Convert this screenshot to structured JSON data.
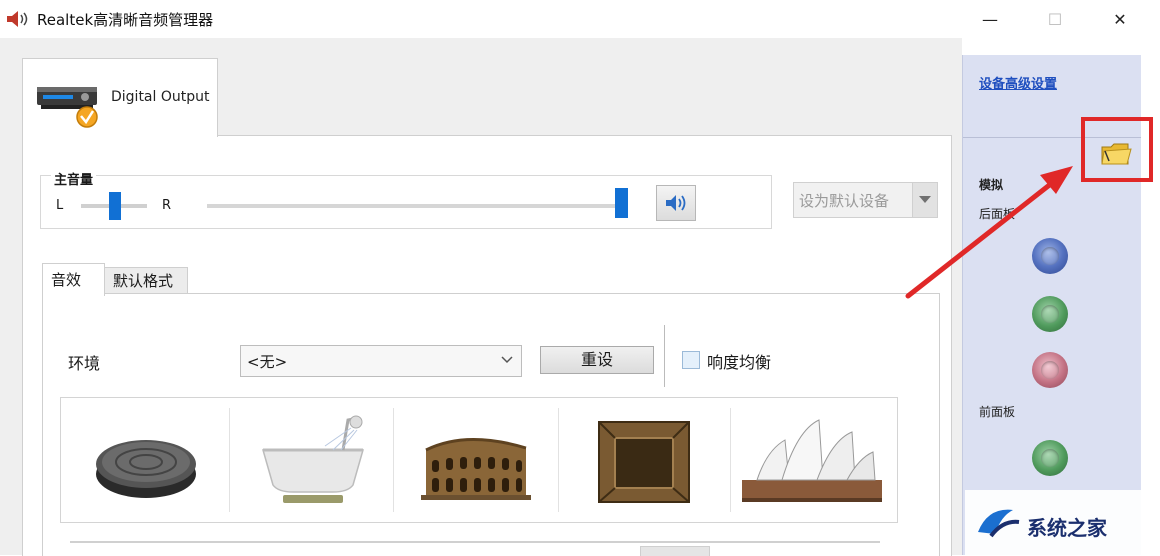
{
  "window": {
    "title": "Realtek高清晰音频管理器",
    "icons": {
      "app": "speaker-app-icon",
      "minimize": "minimize-icon",
      "maximize": "maximize-icon",
      "close": "close-icon"
    },
    "controls": {
      "minimize": "—",
      "maximize": "☐",
      "close": "✕"
    }
  },
  "device_tab": {
    "label": "Digital Output",
    "icon": "digital-output-device-icon"
  },
  "master_volume": {
    "legend": "主音量",
    "left_label": "L",
    "right_label": "R",
    "balance": 0.5,
    "volume": 1.0,
    "mute_icon": "speaker-volume-icon"
  },
  "default_device": {
    "label": "设为默认设备"
  },
  "tabs": [
    {
      "label": "音效",
      "active": true
    },
    {
      "label": "默认格式",
      "active": false
    }
  ],
  "effects": {
    "environment_label": "环境",
    "environment_value": "<无>",
    "reset_label": "重设",
    "loudness_label": "响度均衡",
    "loudness_checked": false,
    "presets": [
      {
        "icon": "sewer-pipe-icon"
      },
      {
        "icon": "bathroom-icon"
      },
      {
        "icon": "colosseum-icon"
      },
      {
        "icon": "stone-room-icon"
      },
      {
        "icon": "opera-house-icon"
      }
    ]
  },
  "side_panel": {
    "advanced_link": "设备高级设置",
    "analog_label": "模拟",
    "rear_panel_label": "后面板",
    "front_panel_label": "前面板",
    "folder_icon": "folder-icon",
    "jacks": [
      {
        "panel": "rear",
        "color": "#5572c0"
      },
      {
        "panel": "rear",
        "color": "#4f9a5c"
      },
      {
        "panel": "rear",
        "color": "#c27183"
      },
      {
        "panel": "front",
        "color": "#4f9a5c"
      }
    ]
  },
  "annotation": {
    "color": "#e02828"
  },
  "watermark": {
    "text": "系统之家"
  },
  "colors": {
    "slider_thumb": "#1170d4",
    "side_panel_bg": "#dbe0f2"
  }
}
